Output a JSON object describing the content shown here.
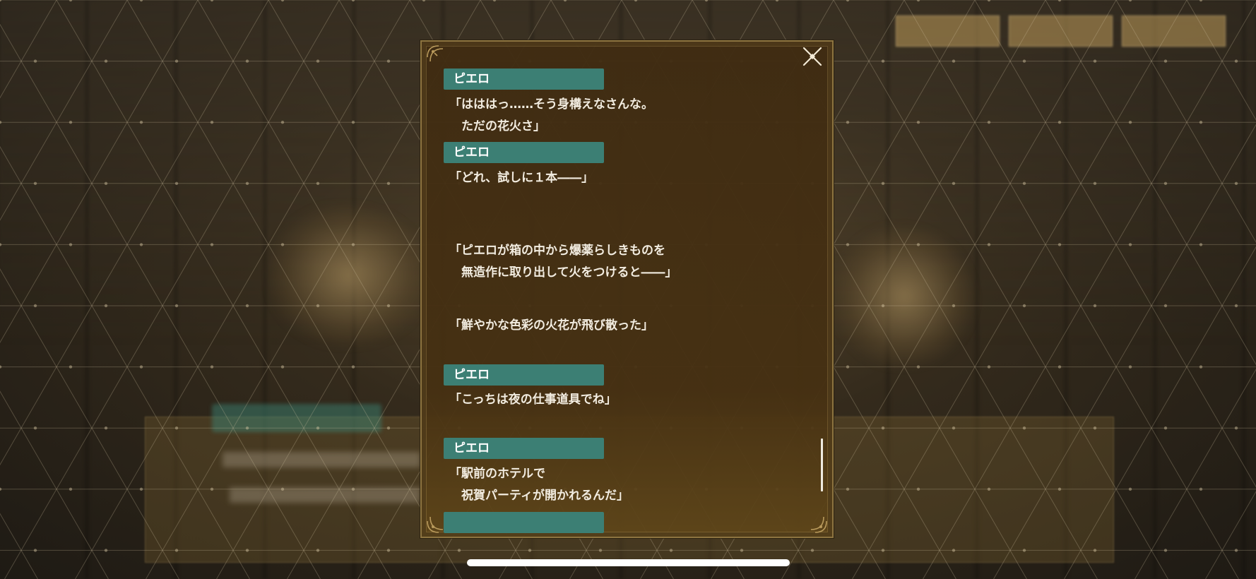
{
  "top_buttons": [
    "",
    "",
    ""
  ],
  "background": {
    "speaker_name": "ピエロ"
  },
  "log": {
    "entries": [
      {
        "speaker": "ピエロ",
        "text": "「はははっ……そう身構えなさんな。\n　ただの花火さ」"
      },
      {
        "speaker": "ピエロ",
        "text": "「どれ、試しに１本――」"
      },
      {
        "speaker": "",
        "text": "「ピエロが箱の中から爆薬らしきものを\n　無造作に取り出して火をつけると――」"
      },
      {
        "speaker": "",
        "text": "「鮮やかな色彩の火花が飛び散った」"
      },
      {
        "speaker": "ピエロ",
        "text": "「こっちは夜の仕事道具でね」"
      },
      {
        "speaker": "ピエロ",
        "text": "「駅前のホテルで\n　祝賀パーティが開かれるんだ」"
      },
      {
        "speaker": "",
        "text": ""
      }
    ]
  },
  "colors": {
    "name_tag": "#3c7f74",
    "panel_border": "#8d7440",
    "text": "#f2ece0"
  },
  "icons": {
    "close": "close-x-icon",
    "corner": "ornament-corner-icon"
  }
}
